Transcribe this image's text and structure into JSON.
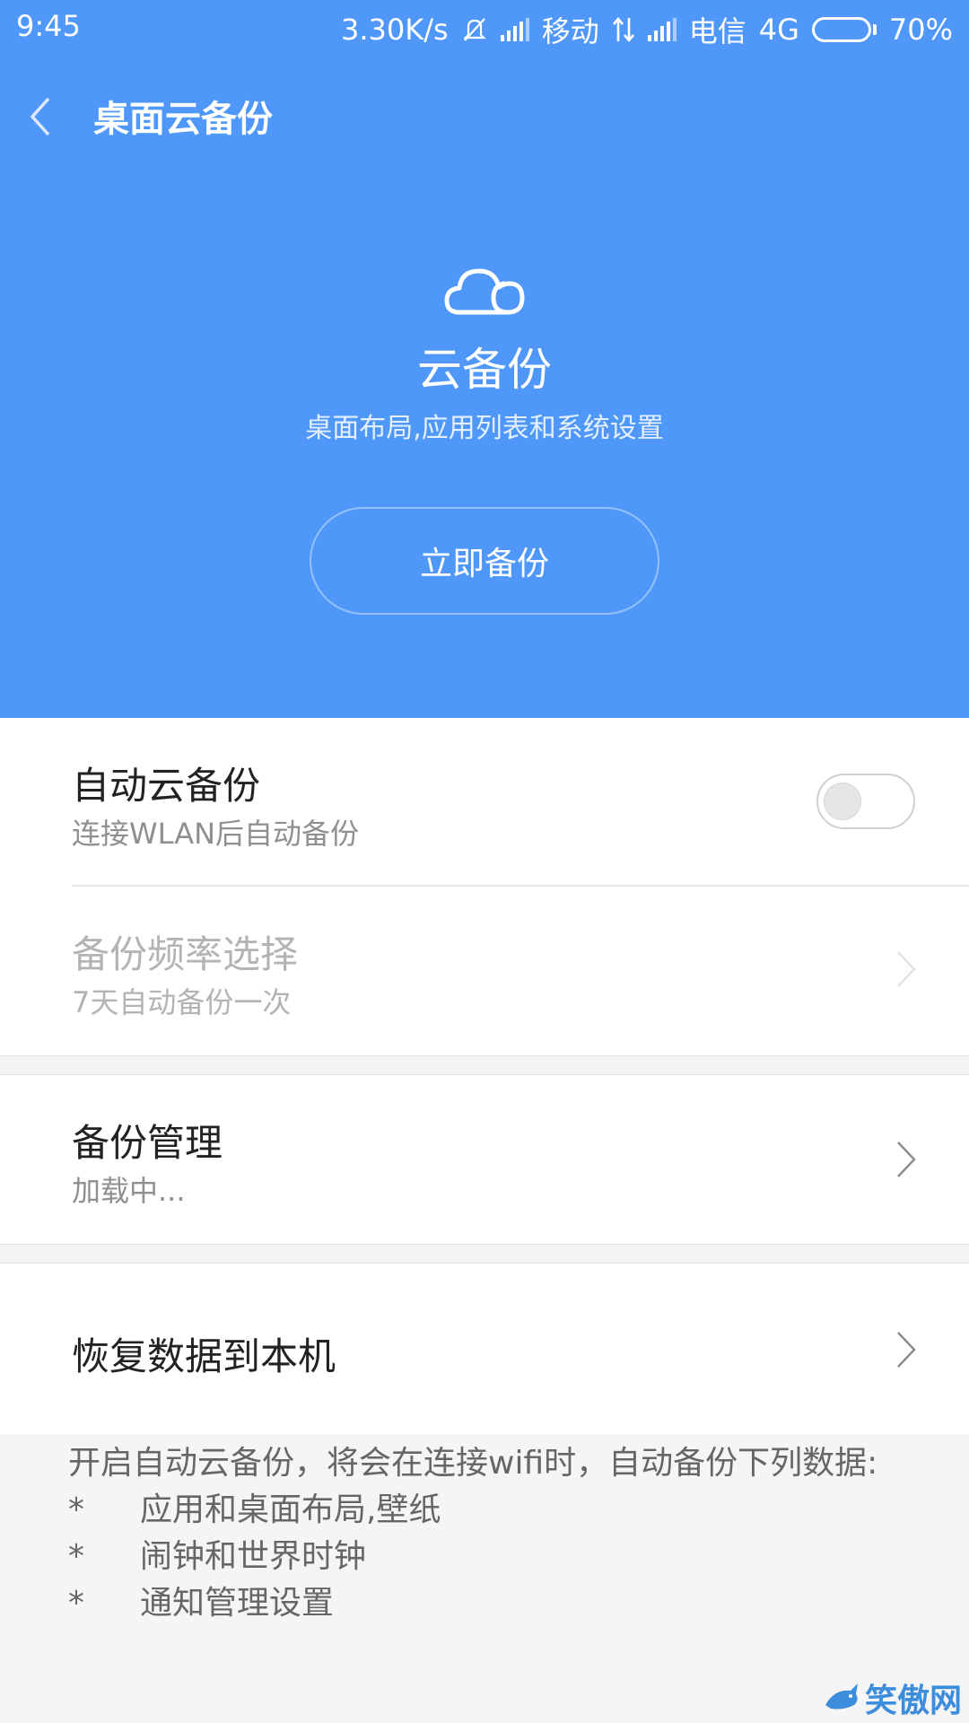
{
  "status_bar": {
    "time": "9:45",
    "speed": "3.30K/s",
    "carrier1": "移动",
    "carrier2": "电信",
    "network": "4G",
    "battery": "70%",
    "battery_level": 0.7,
    "icons": [
      "mute-bell-icon",
      "signal-icon",
      "data-arrows-icon",
      "signal-icon",
      "battery-icon"
    ]
  },
  "title_bar": {
    "back_icon": "back-chevron-icon",
    "title": "桌面云备份"
  },
  "hero": {
    "icon": "cloud-icon",
    "title": "云备份",
    "subtitle": "桌面布局,应用列表和系统设置",
    "button_label": "立即备份"
  },
  "settings": {
    "auto_backup": {
      "title": "自动云备份",
      "subtitle": "连接WLAN后自动备份",
      "enabled": false
    },
    "frequency": {
      "title": "备份频率选择",
      "subtitle": "7天自动备份一次",
      "disabled": true
    },
    "manage": {
      "title": "备份管理",
      "subtitle": "加载中..."
    },
    "restore": {
      "title": "恢复数据到本机"
    }
  },
  "note": {
    "intro": "开启自动云备份，将会在连接wifi时，自动备份下列数据:",
    "items": [
      {
        "bullet": "*",
        "text": "应用和桌面布局,壁纸"
      },
      {
        "bullet": "*",
        "text": "闹钟和世界时钟"
      },
      {
        "bullet": "*",
        "text": "通知管理设置"
      }
    ]
  },
  "watermark": {
    "text": "笑傲网",
    "icon": "shark-logo-icon"
  },
  "colors": {
    "header_bg": "#4f98fa",
    "page_bg": "#f5f5f5",
    "card_bg": "#ffffff"
  }
}
